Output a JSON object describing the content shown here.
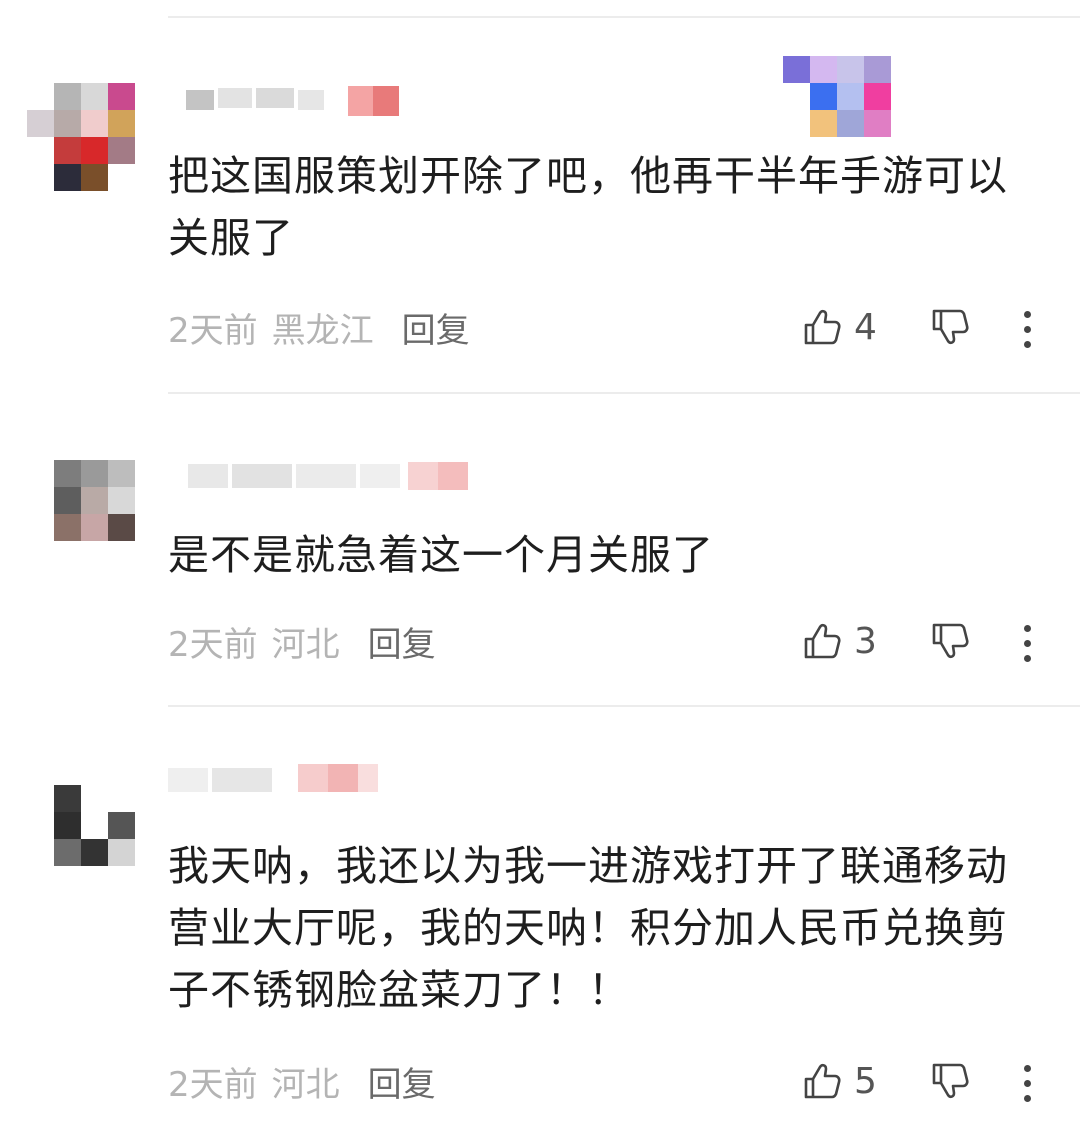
{
  "comments": [
    {
      "text": "把这国服策划开除了吧，他再干半年手游可以关服了",
      "time": "2天前",
      "location": "黑龙江",
      "reply_label": "回复",
      "likes": "4"
    },
    {
      "text": "是不是就急着这一个月关服了",
      "time": "2天前",
      "location": "河北",
      "reply_label": "回复",
      "likes": "3"
    },
    {
      "text": "我天呐，我还以为我一进游戏打开了联通移动营业大厅呢，我的天呐！积分加人民币兑换剪子不锈钢脸盆菜刀了！！",
      "time": "2天前",
      "location": "河北",
      "reply_label": "回复",
      "likes": "5"
    }
  ],
  "icons": {
    "like": "thumbs-up-icon",
    "dislike": "thumbs-down-icon",
    "more": "more-vertical-icon"
  },
  "colors": {
    "meta_gray": "#b4b4b4",
    "reply_gray": "#6a6a6a",
    "icon_dark": "#444444"
  }
}
